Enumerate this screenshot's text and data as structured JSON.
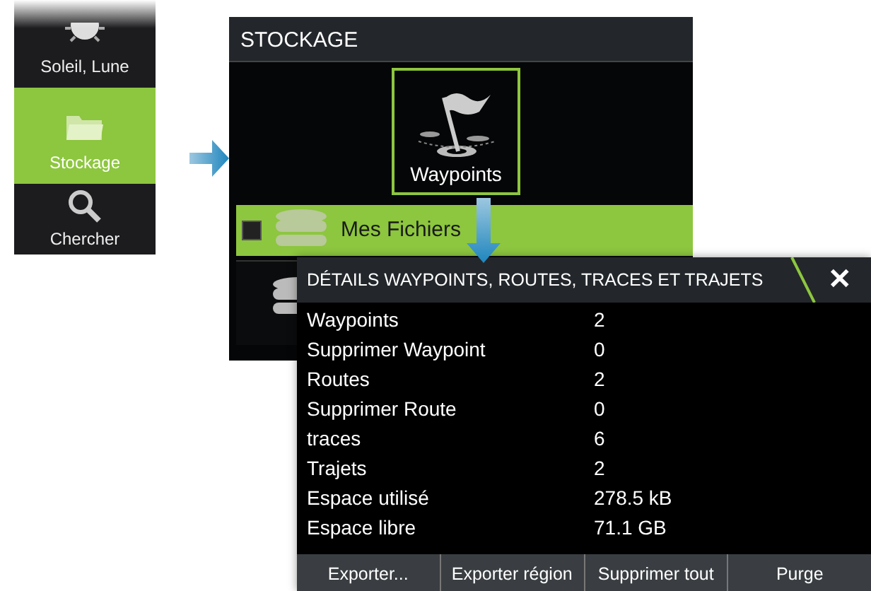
{
  "menu": {
    "items": [
      {
        "label": "Soleil, Lune",
        "selected": false
      },
      {
        "label": "Stockage",
        "selected": true
      },
      {
        "label": "Chercher",
        "selected": false
      }
    ]
  },
  "storage": {
    "title": "STOCKAGE",
    "tile": {
      "label": "Waypoints",
      "selected": true
    },
    "list": [
      {
        "label": "Mes Fichiers",
        "selected": true
      }
    ]
  },
  "dialog": {
    "title": "DÉTAILS WAYPOINTS, ROUTES, TRACES ET TRAJETS",
    "close": "✕",
    "rows": [
      {
        "label": "Waypoints",
        "value": "2"
      },
      {
        "label": "Supprimer Waypoint",
        "value": "0"
      },
      {
        "label": "Routes",
        "value": "2"
      },
      {
        "label": "Supprimer Route",
        "value": "0"
      },
      {
        "label": "traces",
        "value": "6"
      },
      {
        "label": "Trajets",
        "value": "2"
      },
      {
        "label": "Espace utilisé",
        "value": "278.5 kB"
      },
      {
        "label": "Espace libre",
        "value": "71.1 GB"
      }
    ],
    "buttons": [
      "Exporter...",
      "Exporter région",
      "Supprimer tout",
      "Purge"
    ]
  }
}
